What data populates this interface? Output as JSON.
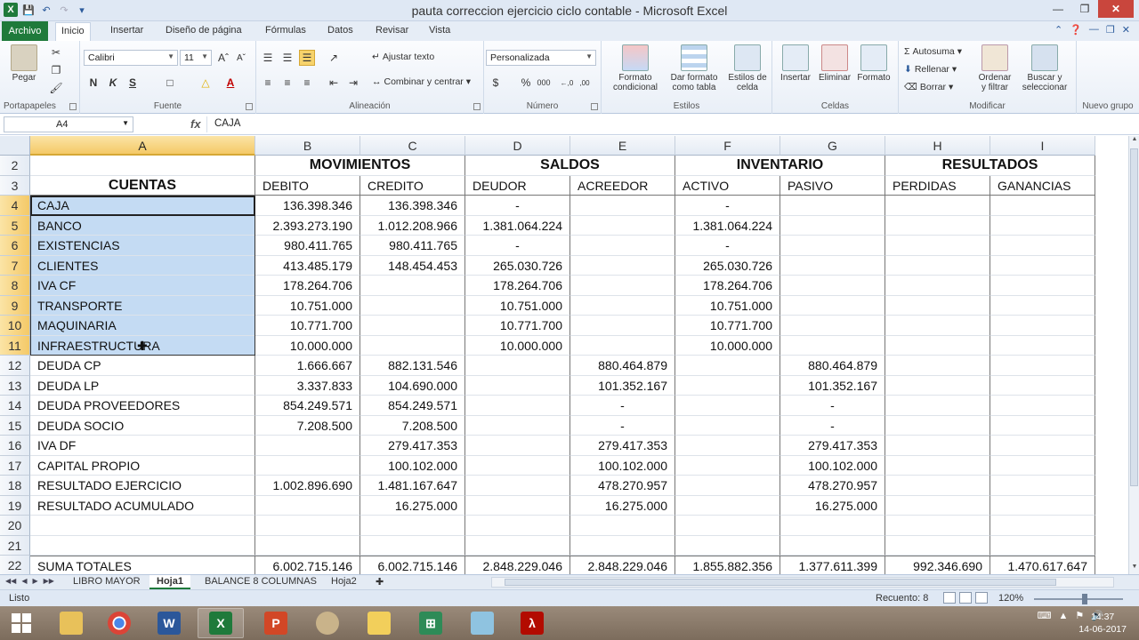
{
  "window": {
    "title": "pauta correccion ejercicio ciclo contable  -  Microsoft Excel"
  },
  "tabs": {
    "file": "Archivo",
    "items": [
      "Inicio",
      "Insertar",
      "Diseño de página",
      "Fórmulas",
      "Datos",
      "Revisar",
      "Vista"
    ]
  },
  "ribbon": {
    "clipboard": {
      "paste": "Pegar",
      "label": "Portapapeles"
    },
    "font": {
      "name": "Calibri",
      "size": "11",
      "bold": "N",
      "italic": "K",
      "underline": "S",
      "label": "Fuente"
    },
    "alignment": {
      "wrap": "Ajustar texto",
      "merge": "Combinar y centrar",
      "label": "Alineación"
    },
    "number": {
      "format": "Personalizada",
      "currency": "$",
      "percent": "%",
      "thousands": "000",
      "dec_inc": "←,0",
      "dec_dec": ",00",
      "label": "Número"
    },
    "styles": {
      "conditional": "Formato condicional",
      "table": "Dar formato como tabla",
      "cell": "Estilos de celda",
      "label": "Estilos"
    },
    "cells": {
      "insert": "Insertar",
      "delete": "Eliminar",
      "format": "Formato",
      "label": "Celdas"
    },
    "editing": {
      "autosum": "Autosuma",
      "fill": "Rellenar",
      "clear": "Borrar",
      "sort": "Ordenar y filtrar",
      "find": "Buscar y seleccionar",
      "label": "Modificar"
    },
    "newgroup": {
      "label": "Nuevo grupo"
    }
  },
  "formula_bar": {
    "name_box": "A4",
    "fx": "fx",
    "content": "CAJA"
  },
  "columns": [
    "A",
    "B",
    "C",
    "D",
    "E",
    "F",
    "G",
    "H",
    "I"
  ],
  "header_rows": {
    "row2": {
      "b": "MOVIMIENTOS",
      "d": "SALDOS",
      "f": "INVENTARIO",
      "h": "RESULTADOS"
    },
    "row3": {
      "a": "CUENTAS",
      "b": "DEBITO",
      "c": "CREDITO",
      "d": "DEUDOR",
      "e": "ACREEDOR",
      "f": "ACTIVO",
      "g": "PASIVO",
      "h": "PERDIDAS",
      "i": "GANANCIAS"
    }
  },
  "rows": [
    {
      "num": "2"
    },
    {
      "num": "3"
    },
    {
      "num": "4",
      "cells": [
        "CAJA",
        "136.398.346",
        "136.398.346",
        "-",
        "",
        "-",
        "",
        "",
        ""
      ]
    },
    {
      "num": "5",
      "cells": [
        "BANCO",
        "2.393.273.190",
        "1.012.208.966",
        "1.381.064.224",
        "",
        "1.381.064.224",
        "",
        "",
        ""
      ]
    },
    {
      "num": "6",
      "cells": [
        "EXISTENCIAS",
        "980.411.765",
        "980.411.765",
        "-",
        "",
        "-",
        "",
        "",
        ""
      ]
    },
    {
      "num": "7",
      "cells": [
        "CLIENTES",
        "413.485.179",
        "148.454.453",
        "265.030.726",
        "",
        "265.030.726",
        "",
        "",
        ""
      ]
    },
    {
      "num": "8",
      "cells": [
        "IVA CF",
        "178.264.706",
        "",
        "178.264.706",
        "",
        "178.264.706",
        "",
        "",
        ""
      ]
    },
    {
      "num": "9",
      "cells": [
        "TRANSPORTE",
        "10.751.000",
        "",
        "10.751.000",
        "",
        "10.751.000",
        "",
        "",
        ""
      ]
    },
    {
      "num": "10",
      "cells": [
        "MAQUINARIA",
        "10.771.700",
        "",
        "10.771.700",
        "",
        "10.771.700",
        "",
        "",
        ""
      ]
    },
    {
      "num": "11",
      "cells": [
        "INFRAESTRUCTURA",
        "10.000.000",
        "",
        "10.000.000",
        "",
        "10.000.000",
        "",
        "",
        ""
      ]
    },
    {
      "num": "12",
      "cells": [
        "DEUDA CP",
        "1.666.667",
        "882.131.546",
        "",
        "880.464.879",
        "",
        "880.464.879",
        "",
        ""
      ]
    },
    {
      "num": "13",
      "cells": [
        "DEUDA LP",
        "3.337.833",
        "104.690.000",
        "",
        "101.352.167",
        "",
        "101.352.167",
        "",
        ""
      ]
    },
    {
      "num": "14",
      "cells": [
        "DEUDA PROVEEDORES",
        "854.249.571",
        "854.249.571",
        "",
        "-",
        "",
        "-",
        "",
        ""
      ]
    },
    {
      "num": "15",
      "cells": [
        "DEUDA SOCIO",
        "7.208.500",
        "7.208.500",
        "",
        "-",
        "",
        "-",
        "",
        ""
      ]
    },
    {
      "num": "16",
      "cells": [
        "IVA DF",
        "",
        "279.417.353",
        "",
        "279.417.353",
        "",
        "279.417.353",
        "",
        ""
      ]
    },
    {
      "num": "17",
      "cells": [
        "CAPITAL PROPIO",
        "",
        "100.102.000",
        "",
        "100.102.000",
        "",
        "100.102.000",
        "",
        ""
      ]
    },
    {
      "num": "18",
      "cells": [
        "RESULTADO EJERCICIO",
        "1.002.896.690",
        "1.481.167.647",
        "",
        "478.270.957",
        "",
        "478.270.957",
        "",
        ""
      ]
    },
    {
      "num": "19",
      "cells": [
        "RESULTADO ACUMULADO",
        "",
        "16.275.000",
        "",
        "16.275.000",
        "",
        "16.275.000",
        "",
        ""
      ]
    },
    {
      "num": "20",
      "cells": [
        "",
        "",
        "",
        "",
        "",
        "",
        "",
        "",
        ""
      ]
    },
    {
      "num": "21",
      "cells": [
        "",
        "",
        "",
        "",
        "",
        "",
        "",
        "",
        ""
      ]
    },
    {
      "num": "22",
      "cells": [
        "SUMA TOTALES",
        "6.002.715.146",
        "6.002.715.146",
        "2.848.229.046",
        "2.848.229.046",
        "1.855.882.356",
        "1.377.611.399",
        "992.346.690",
        "1.470.617.647"
      ]
    }
  ],
  "sheets": [
    "LIBRO MAYOR",
    "Hoja1",
    "BALANCE 8 COLUMNAS",
    "Hoja2"
  ],
  "active_sheet": "Hoja1",
  "status": {
    "ready": "Listo",
    "count": "Recuento: 8",
    "zoom": "120%"
  },
  "clock": {
    "time": "14:37",
    "date": "14-06-2017"
  },
  "colors": {
    "accent": "#1f7a3b",
    "selection": "#c4dbf3",
    "active_header": "#f4c967"
  }
}
